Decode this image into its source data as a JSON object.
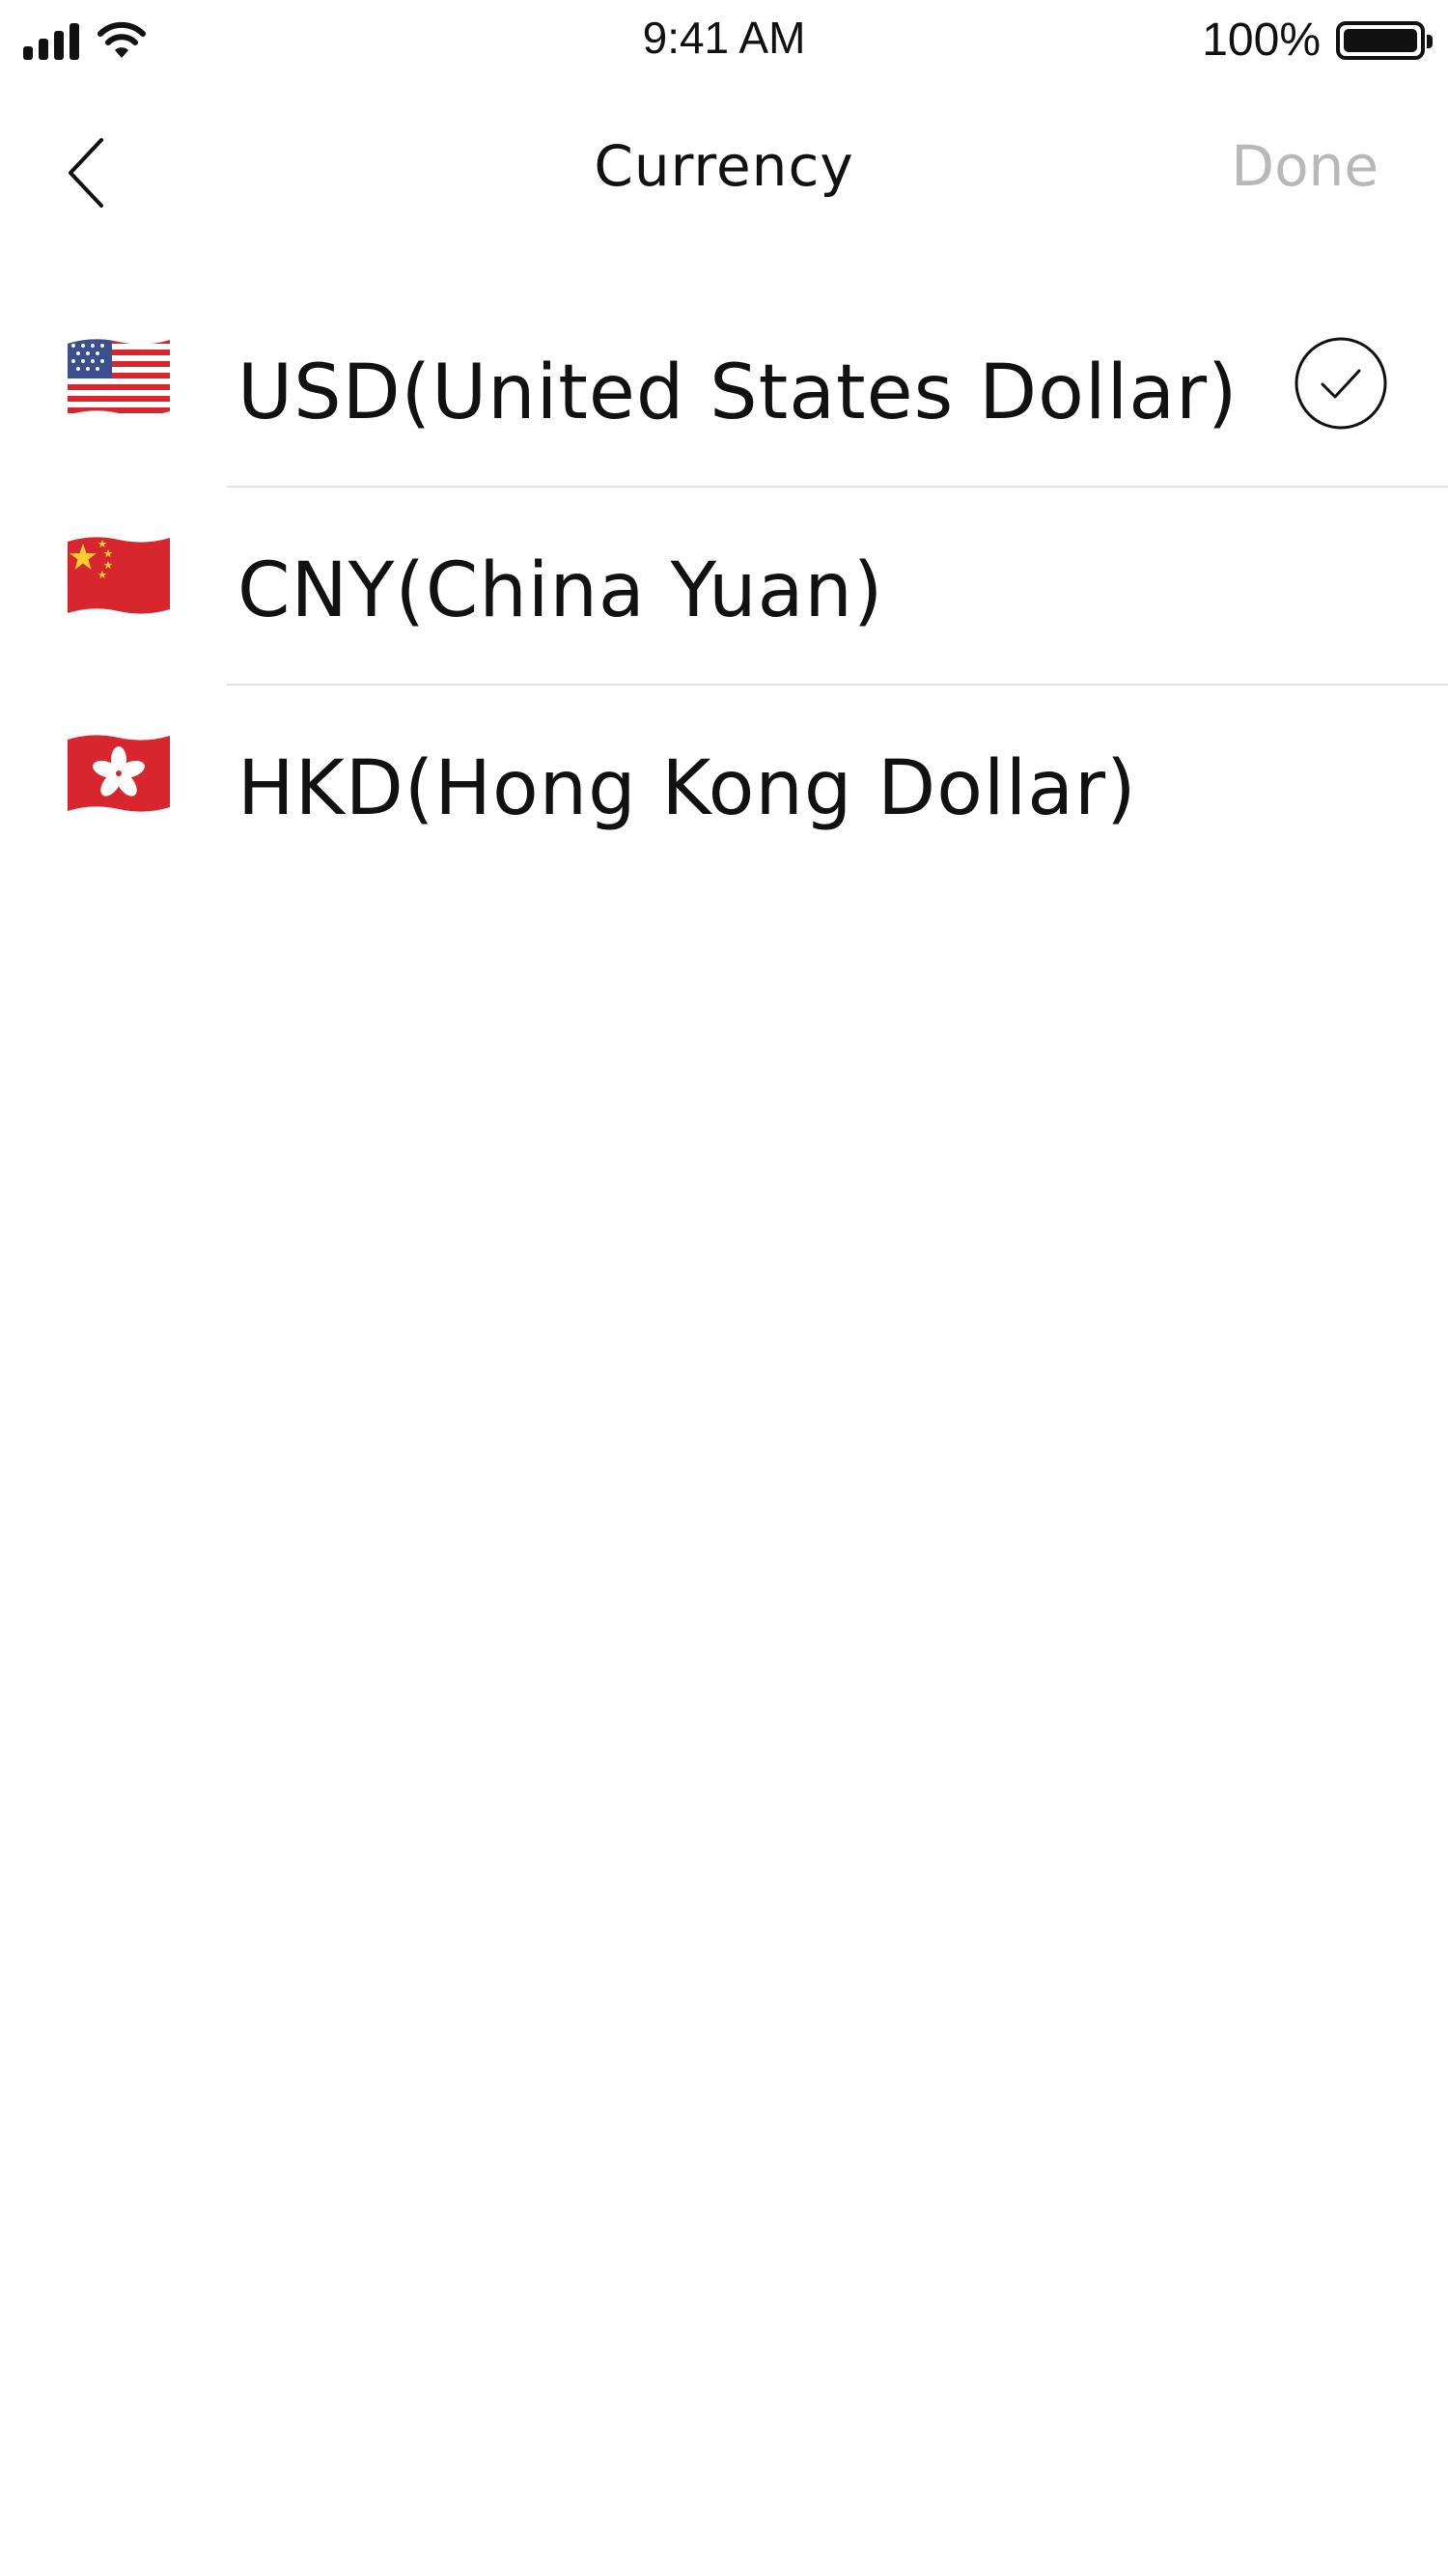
{
  "status_bar": {
    "time": "9:41 AM",
    "battery_percent": "100%",
    "battery_level": 1.0
  },
  "nav": {
    "title": "Currency",
    "done_label": "Done"
  },
  "currencies": [
    {
      "label": "USD(United States Dollar)",
      "flag": "us-flag-icon",
      "selected": true
    },
    {
      "label": "CNY(China Yuan)",
      "flag": "china-flag-icon",
      "selected": false
    },
    {
      "label": "HKD(Hong Kong Dollar)",
      "flag": "hong-kong-flag-icon",
      "selected": false
    }
  ],
  "colors": {
    "text": "#111111",
    "done_disabled": "#b8b8b8",
    "divider": "#e2e2e2",
    "flag_red": "#d7262e"
  }
}
